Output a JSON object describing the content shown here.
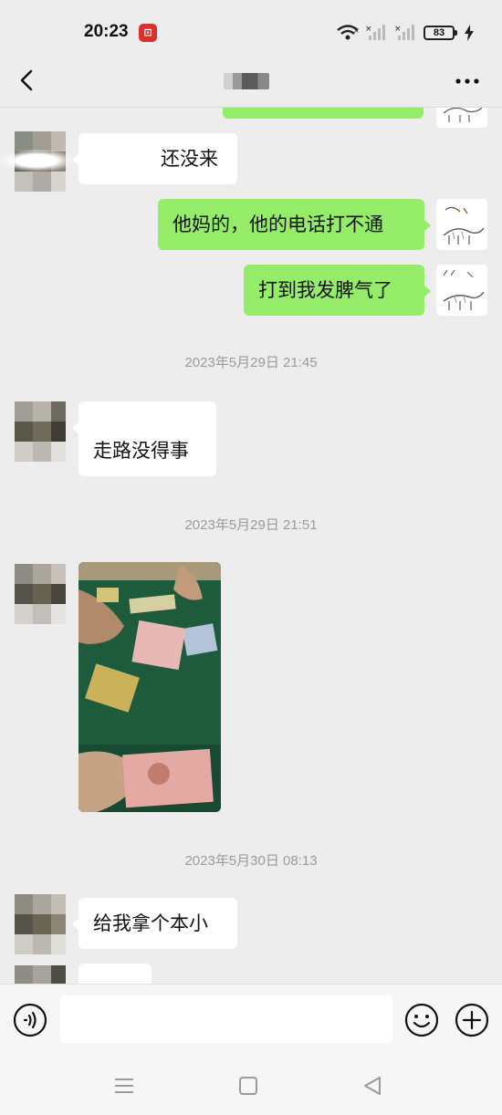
{
  "status_bar": {
    "time": "20:23",
    "app_icon": "bank-app-icon",
    "battery": "83",
    "icons": [
      "wifi-icon",
      "signal-icon",
      "signal-icon",
      "battery-icon",
      "charging-icon"
    ]
  },
  "nav": {
    "back_icon": "chevron-left-icon",
    "more_icon": "more-dots-icon"
  },
  "messages": [
    {
      "side": "in",
      "text": "还没来"
    },
    {
      "side": "out",
      "text": "他妈的，他的电话打不通"
    },
    {
      "side": "out",
      "text": "打到我发脾气了"
    },
    {
      "type": "timestamp",
      "text": "2023年5月29日 21:45"
    },
    {
      "side": "in",
      "text": "走路没得事"
    },
    {
      "type": "timestamp",
      "text": "2023年5月29日 21:51"
    },
    {
      "side": "in",
      "type": "image",
      "icon": "photo-message"
    },
    {
      "type": "timestamp",
      "text": "2023年5月30日 08:13"
    },
    {
      "side": "in",
      "text": "给我拿个本小"
    }
  ],
  "input_bar": {
    "voice_icon": "voice-icon",
    "emoji_icon": "emoji-icon",
    "plus_icon": "plus-icon",
    "value": ""
  },
  "system_nav": {
    "icons": [
      "menu-icon",
      "home-icon",
      "back-triangle-icon"
    ]
  },
  "colors": {
    "background": "#ededed",
    "outgoing_bubble": "#95ec69",
    "incoming_bubble": "#ffffff",
    "timestamp": "#9b9b9b"
  }
}
